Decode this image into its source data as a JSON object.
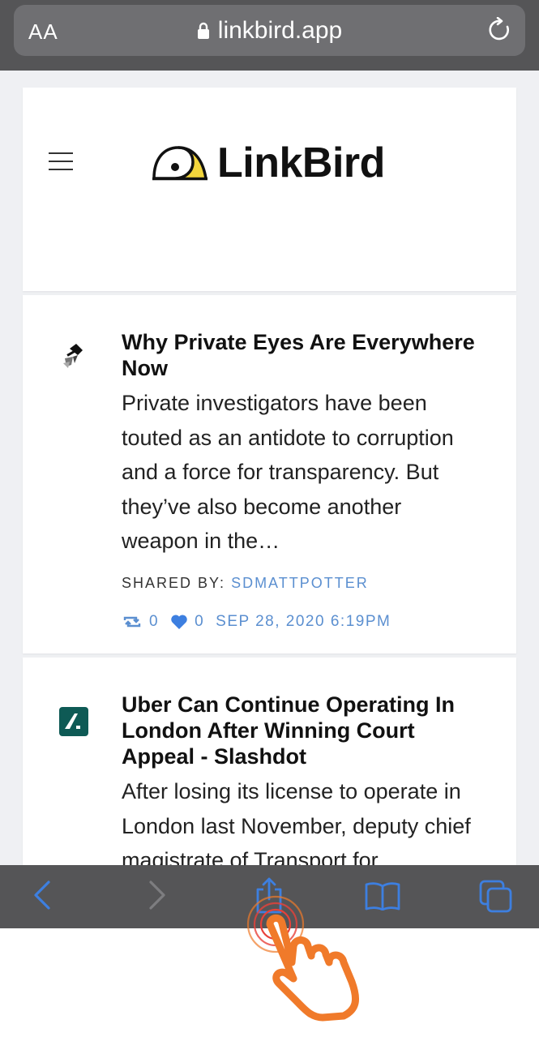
{
  "browser": {
    "text_size_label": "AA",
    "url": "linkbird.app"
  },
  "site": {
    "logo_text": "LinkBird"
  },
  "posts": [
    {
      "title": "Why Private Eyes Are Everywhere Now",
      "excerpt": "Private investigators have been touted as an antidote to corruption and a force for transparency. But they’ve also become another weapon in the…",
      "shared_by_label": "SHARED BY:",
      "shared_by_user": "SDMATTPOTTER",
      "reposts": "0",
      "likes": "0",
      "date": "SEP 28, 2020 6:19PM"
    },
    {
      "title": "Uber Can Continue Operating In London After Winning Court Appeal - Slashdot",
      "excerpt": "After losing its license to operate in London last November, deputy chief magistrate of Transport for"
    }
  ],
  "colors": {
    "accent": "#5b8fd0",
    "toolbar_icons": "#3d7fe0",
    "bar_bg": "#555557",
    "hand": "#f07a2a"
  },
  "toolbar": {
    "icons": [
      "back-icon",
      "forward-icon",
      "share-icon",
      "bookmarks-icon",
      "tabs-icon"
    ]
  }
}
